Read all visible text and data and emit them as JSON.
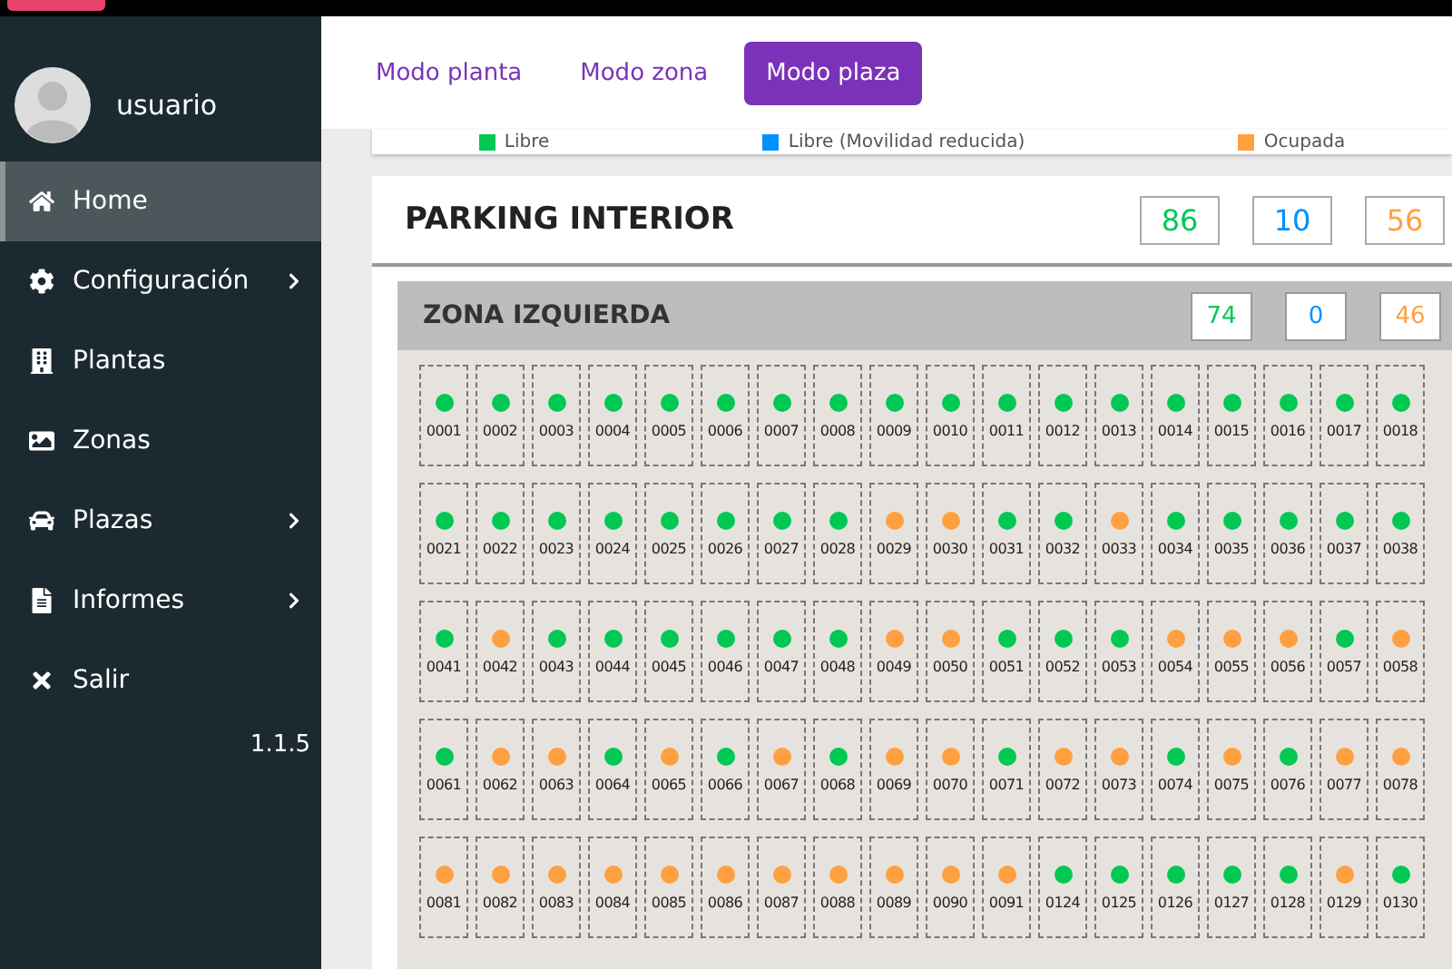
{
  "user": {
    "name": "usuario"
  },
  "menu": [
    {
      "label": "Home",
      "selected": true,
      "submenu": false
    },
    {
      "label": "Configuración",
      "selected": false,
      "submenu": true
    },
    {
      "label": "Plantas",
      "selected": false,
      "submenu": false
    },
    {
      "label": "Zonas",
      "selected": false,
      "submenu": false
    },
    {
      "label": "Plazas",
      "selected": false,
      "submenu": true
    },
    {
      "label": "Informes",
      "selected": false,
      "submenu": true
    },
    {
      "label": "Salir",
      "selected": false,
      "submenu": false
    }
  ],
  "version": "1.1.5",
  "tabs": [
    {
      "label": "Modo planta",
      "selected": false
    },
    {
      "label": "Modo zona",
      "selected": false
    },
    {
      "label": "Modo plaza",
      "selected": true
    }
  ],
  "legend": [
    {
      "label": "Libre",
      "color": "#00c853"
    },
    {
      "label": "Libre (Movilidad reducida)",
      "color": "#0091ff"
    },
    {
      "label": "Ocupada",
      "color": "#ffa040"
    }
  ],
  "parking": {
    "title": "PARKING INTERIOR",
    "counts": [
      {
        "value": "86",
        "color": "#00c853"
      },
      {
        "value": "10",
        "color": "#0091ff"
      },
      {
        "value": "56",
        "color": "#ffa040"
      }
    ],
    "zone": {
      "title": "ZONA IZQUIERDA",
      "counts": [
        {
          "value": "74",
          "color": "#00c853"
        },
        {
          "value": "0",
          "color": "#0091ff"
        },
        {
          "value": "46",
          "color": "#ffa040"
        }
      ],
      "slots": [
        {
          "number": "0001",
          "color": "#00c853"
        },
        {
          "number": "0002",
          "color": "#00c853"
        },
        {
          "number": "0003",
          "color": "#00c853"
        },
        {
          "number": "0004",
          "color": "#00c853"
        },
        {
          "number": "0005",
          "color": "#00c853"
        },
        {
          "number": "0006",
          "color": "#00c853"
        },
        {
          "number": "0007",
          "color": "#00c853"
        },
        {
          "number": "0008",
          "color": "#00c853"
        },
        {
          "number": "0009",
          "color": "#00c853"
        },
        {
          "number": "0010",
          "color": "#00c853"
        },
        {
          "number": "0011",
          "color": "#00c853"
        },
        {
          "number": "0012",
          "color": "#00c853"
        },
        {
          "number": "0013",
          "color": "#00c853"
        },
        {
          "number": "0014",
          "color": "#00c853"
        },
        {
          "number": "0015",
          "color": "#00c853"
        },
        {
          "number": "0016",
          "color": "#00c853"
        },
        {
          "number": "0017",
          "color": "#00c853"
        },
        {
          "number": "0018",
          "color": "#00c853"
        },
        {
          "number": "0021",
          "color": "#00c853"
        },
        {
          "number": "0022",
          "color": "#00c853"
        },
        {
          "number": "0023",
          "color": "#00c853"
        },
        {
          "number": "0024",
          "color": "#00c853"
        },
        {
          "number": "0025",
          "color": "#00c853"
        },
        {
          "number": "0026",
          "color": "#00c853"
        },
        {
          "number": "0027",
          "color": "#00c853"
        },
        {
          "number": "0028",
          "color": "#00c853"
        },
        {
          "number": "0029",
          "color": "#ffa040"
        },
        {
          "number": "0030",
          "color": "#ffa040"
        },
        {
          "number": "0031",
          "color": "#00c853"
        },
        {
          "number": "0032",
          "color": "#00c853"
        },
        {
          "number": "0033",
          "color": "#ffa040"
        },
        {
          "number": "0034",
          "color": "#00c853"
        },
        {
          "number": "0035",
          "color": "#00c853"
        },
        {
          "number": "0036",
          "color": "#00c853"
        },
        {
          "number": "0037",
          "color": "#00c853"
        },
        {
          "number": "0038",
          "color": "#00c853"
        },
        {
          "number": "0041",
          "color": "#00c853"
        },
        {
          "number": "0042",
          "color": "#ffa040"
        },
        {
          "number": "0043",
          "color": "#00c853"
        },
        {
          "number": "0044",
          "color": "#00c853"
        },
        {
          "number": "0045",
          "color": "#00c853"
        },
        {
          "number": "0046",
          "color": "#00c853"
        },
        {
          "number": "0047",
          "color": "#00c853"
        },
        {
          "number": "0048",
          "color": "#00c853"
        },
        {
          "number": "0049",
          "color": "#ffa040"
        },
        {
          "number": "0050",
          "color": "#ffa040"
        },
        {
          "number": "0051",
          "color": "#00c853"
        },
        {
          "number": "0052",
          "color": "#00c853"
        },
        {
          "number": "0053",
          "color": "#00c853"
        },
        {
          "number": "0054",
          "color": "#ffa040"
        },
        {
          "number": "0055",
          "color": "#ffa040"
        },
        {
          "number": "0056",
          "color": "#ffa040"
        },
        {
          "number": "0057",
          "color": "#00c853"
        },
        {
          "number": "0058",
          "color": "#ffa040"
        },
        {
          "number": "0061",
          "color": "#00c853"
        },
        {
          "number": "0062",
          "color": "#ffa040"
        },
        {
          "number": "0063",
          "color": "#ffa040"
        },
        {
          "number": "0064",
          "color": "#00c853"
        },
        {
          "number": "0065",
          "color": "#ffa040"
        },
        {
          "number": "0066",
          "color": "#00c853"
        },
        {
          "number": "0067",
          "color": "#ffa040"
        },
        {
          "number": "0068",
          "color": "#00c853"
        },
        {
          "number": "0069",
          "color": "#ffa040"
        },
        {
          "number": "0070",
          "color": "#ffa040"
        },
        {
          "number": "0071",
          "color": "#00c853"
        },
        {
          "number": "0072",
          "color": "#ffa040"
        },
        {
          "number": "0073",
          "color": "#ffa040"
        },
        {
          "number": "0074",
          "color": "#00c853"
        },
        {
          "number": "0075",
          "color": "#ffa040"
        },
        {
          "number": "0076",
          "color": "#00c853"
        },
        {
          "number": "0077",
          "color": "#ffa040"
        },
        {
          "number": "0078",
          "color": "#ffa040"
        },
        {
          "number": "0081",
          "color": "#ffa040"
        },
        {
          "number": "0082",
          "color": "#ffa040"
        },
        {
          "number": "0083",
          "color": "#ffa040"
        },
        {
          "number": "0084",
          "color": "#ffa040"
        },
        {
          "number": "0085",
          "color": "#ffa040"
        },
        {
          "number": "0086",
          "color": "#ffa040"
        },
        {
          "number": "0087",
          "color": "#ffa040"
        },
        {
          "number": "0088",
          "color": "#ffa040"
        },
        {
          "number": "0089",
          "color": "#ffa040"
        },
        {
          "number": "0090",
          "color": "#ffa040"
        },
        {
          "number": "0091",
          "color": "#ffa040"
        },
        {
          "number": "0124",
          "color": "#00c853"
        },
        {
          "number": "0125",
          "color": "#00c853"
        },
        {
          "number": "0126",
          "color": "#00c853"
        },
        {
          "number": "0127",
          "color": "#00c853"
        },
        {
          "number": "0128",
          "color": "#00c853"
        },
        {
          "number": "0129",
          "color": "#ffa040"
        },
        {
          "number": "0130",
          "color": "#00c853"
        }
      ]
    }
  }
}
